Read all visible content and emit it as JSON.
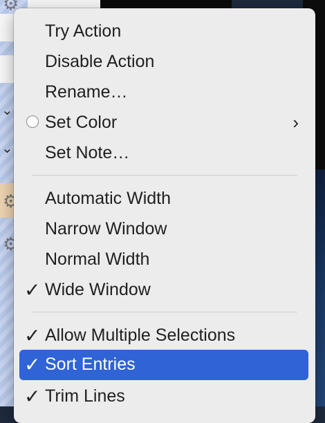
{
  "menu": {
    "items": [
      {
        "label": "Try Action"
      },
      {
        "label": "Disable Action"
      },
      {
        "label": "Rename…"
      },
      {
        "label": "Set Color"
      },
      {
        "label": "Set Note…"
      },
      {
        "label": "Automatic Width"
      },
      {
        "label": "Narrow Window"
      },
      {
        "label": "Normal Width"
      },
      {
        "label": "Wide Window",
        "checked": true
      },
      {
        "label": "Allow Multiple Selections",
        "checked": true
      },
      {
        "label": "Sort Entries",
        "checked": true,
        "highlighted": true
      },
      {
        "label": "Trim Lines",
        "checked": true
      }
    ],
    "check_glyph": "✓",
    "submenu_glyph": "›",
    "highlight_color": "#2f63d6"
  }
}
